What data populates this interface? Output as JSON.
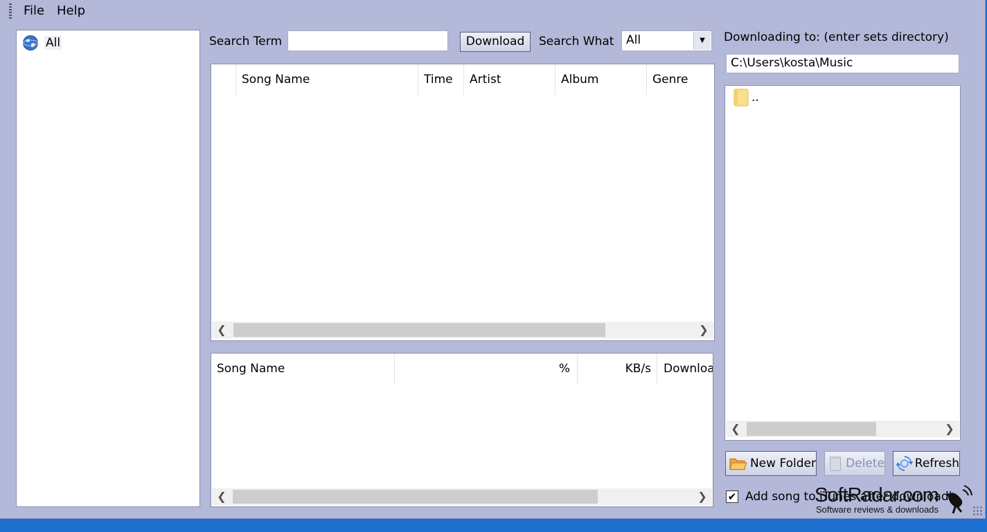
{
  "menu": {
    "file": "File",
    "help": "Help"
  },
  "tree": {
    "root_label": "All"
  },
  "search": {
    "term_label": "Search Term",
    "term_value": "",
    "download_button": "Download",
    "what_label": "Search What",
    "what_selected": "All"
  },
  "results_table": {
    "columns": [
      "Song Name",
      "Time",
      "Artist",
      "Album",
      "Genre"
    ]
  },
  "downloads_table": {
    "columns": [
      "Song Name",
      "%",
      "KB/s",
      "Downloa"
    ]
  },
  "directory": {
    "label": "Downloading to: (enter sets directory)",
    "path": "C:\\Users\\kosta\\Music",
    "items": [
      {
        "name": "..",
        "icon": "folder-icon"
      }
    ]
  },
  "buttons": {
    "new_folder": "New Folder",
    "delete": "Delete",
    "refresh": "Refresh"
  },
  "add_song": {
    "label": "Add song to iTunes after downloading",
    "checked": true
  },
  "watermark": {
    "title": "SoftRadar.com",
    "subtitle": "Software reviews & downloads"
  }
}
